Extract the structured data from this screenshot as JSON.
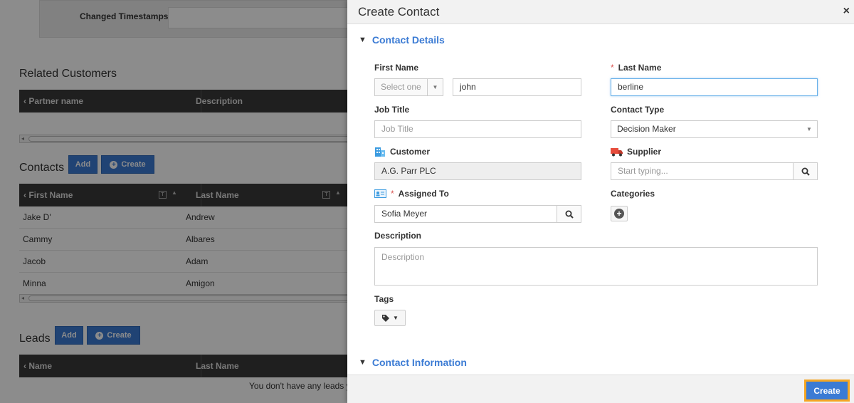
{
  "background": {
    "timestamps_label": "Changed Timestamps",
    "related_customers": {
      "title": "Related Customers",
      "columns": [
        "Partner name",
        "Description"
      ]
    },
    "contacts": {
      "title": "Contacts",
      "add_label": "Add",
      "create_label": "Create",
      "columns": [
        "First Name",
        "Last Name"
      ],
      "rows": [
        {
          "first": "Jake D'",
          "last": "Andrew"
        },
        {
          "first": "Cammy",
          "last": "Albares"
        },
        {
          "first": "Jacob",
          "last": "Adam"
        },
        {
          "first": "Minna",
          "last": "Amigon"
        }
      ]
    },
    "leads": {
      "title": "Leads",
      "add_label": "Add",
      "create_label": "Create",
      "columns": [
        "Name",
        "Last Name"
      ],
      "empty_message": "You don't have any leads ye"
    }
  },
  "modal": {
    "title": "Create Contact",
    "close_glyph": "×",
    "sections": {
      "details": "Contact Details",
      "information": "Contact Information"
    },
    "fields": {
      "first_name": {
        "label": "First Name",
        "salutation_placeholder": "Select one",
        "value": "john"
      },
      "last_name": {
        "label": "Last Name",
        "value": "berline"
      },
      "job_title": {
        "label": "Job Title",
        "placeholder": "Job Title"
      },
      "contact_type": {
        "label": "Contact Type",
        "value": "Decision Maker"
      },
      "customer": {
        "label": "Customer",
        "value": "A.G. Parr PLC"
      },
      "supplier": {
        "label": "Supplier",
        "placeholder": "Start typing..."
      },
      "assigned_to": {
        "label": "Assigned To",
        "value": "Sofia Meyer"
      },
      "categories": {
        "label": "Categories"
      },
      "description": {
        "label": "Description",
        "placeholder": "Description"
      },
      "tags": {
        "label": "Tags"
      }
    },
    "create_label": "Create"
  },
  "colors": {
    "accent": "#3b7bd4",
    "highlight_border": "#f5a623",
    "required": "#d9534f"
  }
}
